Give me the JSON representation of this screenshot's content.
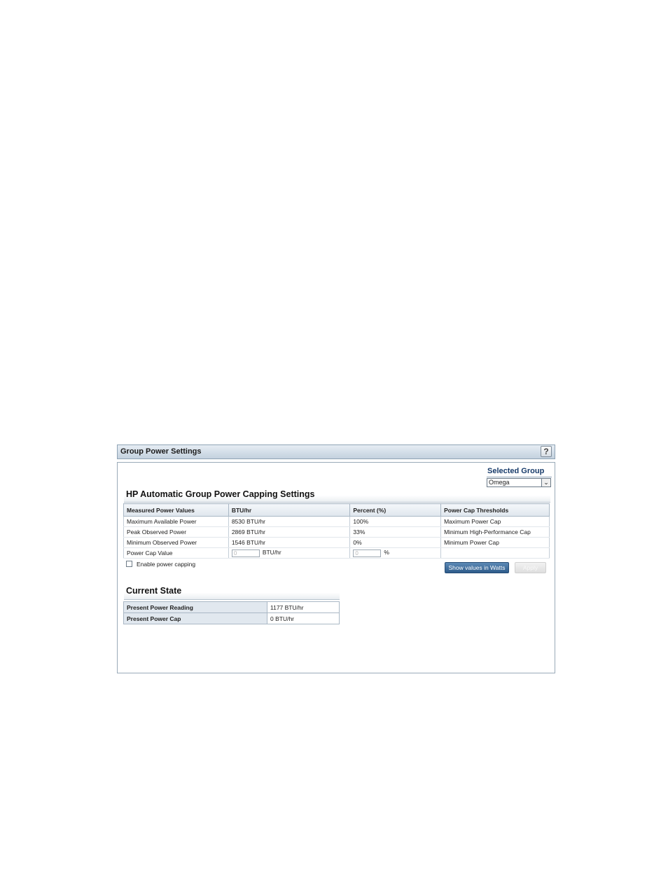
{
  "panel": {
    "title": "Group Power Settings",
    "help_label": "?"
  },
  "selected_group": {
    "label": "Selected Group",
    "value": "Omega"
  },
  "settings": {
    "heading": "HP Automatic Group Power Capping Settings",
    "columns": [
      "Measured Power Values",
      "BTU/hr",
      "Percent (%)",
      "Power Cap Thresholds"
    ],
    "rows": [
      [
        "Maximum Available Power",
        "8530 BTU/hr",
        "100%",
        "Maximum Power Cap"
      ],
      [
        "Peak Observed Power",
        "2869 BTU/hr",
        "33%",
        "Minimum High-Performance Cap"
      ],
      [
        "Minimum Observed Power",
        "1546 BTU/hr",
        "0%",
        "Minimum Power Cap"
      ]
    ],
    "cap_row": {
      "label": "Power Cap Value",
      "btu_value": "0",
      "btu_unit": "BTU/hr",
      "pct_value": "0",
      "pct_unit": "%"
    }
  },
  "enable_capping": {
    "label": "Enable power capping",
    "checked": false
  },
  "buttons": {
    "show_watts": "Show values in Watts",
    "apply": "Apply"
  },
  "current_state": {
    "heading": "Current State",
    "rows": [
      [
        "Present Power Reading",
        "1177 BTU/hr"
      ],
      [
        "Present Power Cap",
        "0 BTU/hr"
      ]
    ]
  }
}
